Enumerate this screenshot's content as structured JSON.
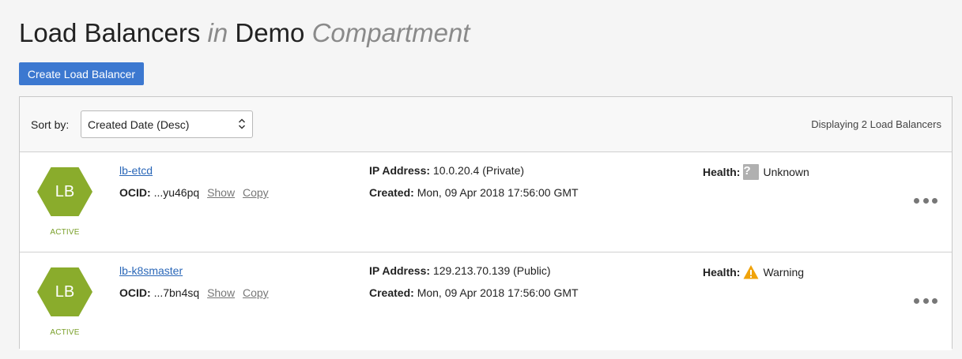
{
  "page": {
    "title_part1": "Load Balancers",
    "title_in": "in",
    "title_compartment": "Demo",
    "title_part2": "Compartment"
  },
  "actions": {
    "create_label": "Create Load Balancer"
  },
  "toolbar": {
    "sort_label": "Sort by:",
    "sort_value": "Created Date (Desc)",
    "display_count": "Displaying 2 Load Balancers"
  },
  "labels": {
    "ocid": "OCID:",
    "show": "Show",
    "copy": "Copy",
    "ip_address": "IP Address:",
    "created": "Created:",
    "health": "Health:"
  },
  "load_balancers": [
    {
      "badge": "LB",
      "state": "ACTIVE",
      "name": "lb-etcd",
      "ocid_short": "...yu46pq",
      "ip": "10.0.20.4 (Private)",
      "created": "Mon, 09 Apr 2018 17:56:00 GMT",
      "health_icon": "question-icon",
      "health": "Unknown"
    },
    {
      "badge": "LB",
      "state": "ACTIVE",
      "name": "lb-k8smaster",
      "ocid_short": "...7bn4sq",
      "ip": "129.213.70.139 (Public)",
      "created": "Mon, 09 Apr 2018 17:56:00 GMT",
      "health_icon": "warning-icon",
      "health": "Warning"
    }
  ],
  "colors": {
    "accent": "#3c78d0",
    "active_green": "#7aa02a",
    "hex_green": "#8aac2c",
    "warning": "#f0a30a"
  }
}
